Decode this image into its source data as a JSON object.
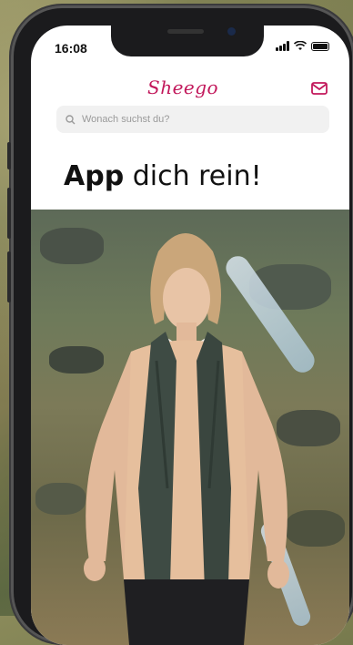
{
  "status": {
    "time": "16:08"
  },
  "header": {
    "logo_text": "Sheego",
    "mail_icon": "mail-icon"
  },
  "search": {
    "placeholder": "Wonach suchst du?",
    "icon": "search-icon"
  },
  "headline": {
    "bold": "App",
    "rest": " dich rein!"
  },
  "colors": {
    "brand": "#c2185b",
    "text": "#111111",
    "search_bg": "#f1f1f1"
  }
}
